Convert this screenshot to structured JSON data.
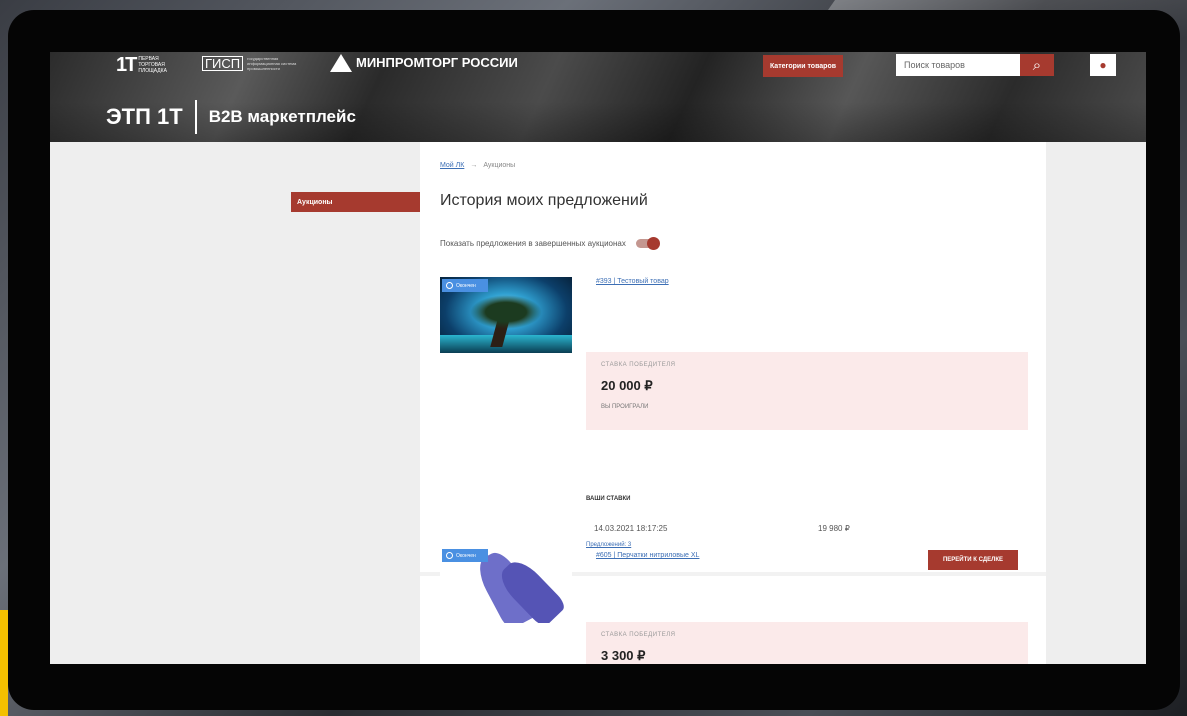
{
  "header": {
    "logo1_mark": "1Т",
    "logo1_text": "ПЕРВАЯ ТОРГОВАЯ ПЛОЩАДКА",
    "logo2_mark": "ГИСП",
    "logo2_text": "государственная информационная система промышленности",
    "logo3_text": "МИНПРОМТОРГ РОССИИ",
    "categories_button": "Категории товаров",
    "search_placeholder": "Поиск товаров",
    "search_icon": "search-icon",
    "user_icon": "user-icon"
  },
  "brand": {
    "etp": "ЭТП 1Т",
    "b2b": "B2B маркетплейс"
  },
  "sidebar": {
    "items": [
      {
        "label": "Аукционы"
      }
    ]
  },
  "breadcrumb": {
    "root": "Мой ЛК",
    "arrow": "→",
    "current": "Аукционы"
  },
  "page": {
    "title": "История моих предложений",
    "toggle_label": "Показать предложения в завершенных аукционах"
  },
  "lots": [
    {
      "badge": "Окончен",
      "link": "#393 | Тестовый товар",
      "winner_label": "СТАВКА ПОБЕДИТЕЛЯ",
      "winner_price": "20 000 ₽",
      "status": "ВЫ ПРОИГРАЛИ",
      "bids_title": "ВАШИ СТАВКИ",
      "bid_date": "14.03.2021 18:17:25",
      "bid_amount": "19 980 ₽",
      "bids_link": "Предложений: 3"
    },
    {
      "badge": "Окончен",
      "link": "#605 | Перчатки нитриловые XL",
      "deal_button": "ПЕРЕЙТИ К СДЕЛКЕ",
      "winner_label": "СТАВКА ПОБЕДИТЕЛЯ",
      "winner_price": "3 300 ₽"
    }
  ],
  "colors": {
    "accent": "#a63a2f",
    "badge": "#4a90e2",
    "win_bg": "#fbeaea"
  }
}
